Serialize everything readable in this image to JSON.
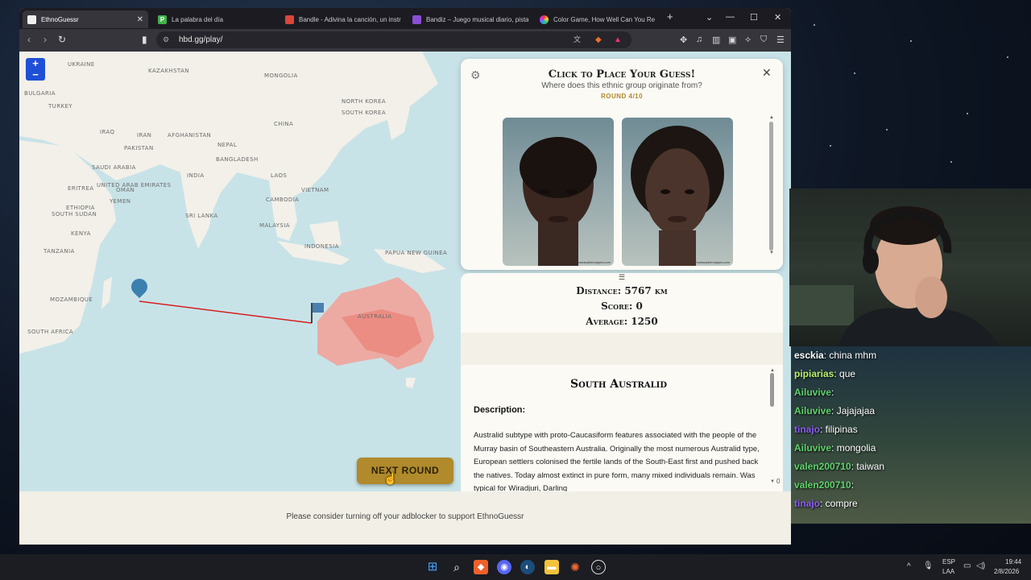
{
  "browser": {
    "tabs": [
      {
        "label": "EthnoGuessr",
        "active": true
      },
      {
        "label": "La palabra del día",
        "active": false
      },
      {
        "label": "Bandle - Adivina la canción, un instr",
        "active": false
      },
      {
        "label": "Bandiz – Juego musical diario, pista",
        "active": false
      },
      {
        "label": "Color Game, How Well Can You Re",
        "active": false
      }
    ],
    "new_tab": "+",
    "url": "hbd.gg/play/"
  },
  "map": {
    "labels": [
      "UKRAINE",
      "KAZAKHSTAN",
      "MONGOLIA",
      "BULGARIA",
      "TURKEY",
      "NORTH KOREA",
      "SOUTH KOREA",
      "CHINA",
      "IRAQ",
      "IRAN",
      "AFGHANISTAN",
      "PAKISTAN",
      "NEPAL",
      "BANGLADESH",
      "SAUDI ARABIA",
      "UNITED ARAB EMIRATES",
      "OMAN",
      "INDIA",
      "LAOS",
      "ERITREA",
      "YEMEN",
      "VIETNAM",
      "CAMBODIA",
      "ETHIOPIA",
      "SOUTH SUDAN",
      "SRI LANKA",
      "MALAYSIA",
      "KENYA",
      "TANZANIA",
      "INDONESIA",
      "PAPUA NEW GUINEA",
      "MOZAMBIQUE",
      "AUSTRALIA",
      "SOUTH AFRICA"
    ],
    "zoom_in": "+",
    "zoom_out": "−",
    "next_round": "NEXT ROUND",
    "footer": "Please consider turning off your adblocker to support EthnoGuessr"
  },
  "guess": {
    "title": "Click to Place Your Guess!",
    "subtitle": "Where does this ethnic group originate from?",
    "round": "ROUND 4/10",
    "faces": [
      "male-face",
      "female-face"
    ],
    "credits": [
      "humanphenotypes.com",
      "humanphenotypes.com"
    ]
  },
  "result": {
    "handle": "☰",
    "distance": "Distance: 5767 km",
    "score": "Score: 0",
    "average": "Average: 1250",
    "group_name": "South Australid",
    "description_label": "Description:",
    "description": "Australid subtype with proto-Caucasiform features associated with the people of the Murray basin of Southeastern Australia. Originally the most numerous Australid type, European settlers colonised the fertile lands of the South-East first and pushed back the natives. Today almost extinct in pure form, many mixed individuals remain. Was typical for Wiradjuri, Darling",
    "scroll_value": "0"
  },
  "chat": [
    {
      "user": "esckia",
      "text": ": china mhm",
      "color": "#ffffff"
    },
    {
      "user": "pipiarias",
      "text": ": que",
      "color": "#b8f06a"
    },
    {
      "user": "Ailuvive",
      "text": ": ",
      "color": "#5fd16b"
    },
    {
      "user": "Ailuvive",
      "text": ": Jajajajaa",
      "color": "#5fd16b"
    },
    {
      "user": "tinajo",
      "text": ": filipinas",
      "color": "#8a5cf0"
    },
    {
      "user": "Ailuvive",
      "text": ": mongolia",
      "color": "#5fd16b"
    },
    {
      "user": "valen200710",
      "text": ": taiwan",
      "color": "#5fd16b"
    },
    {
      "user": "valen200710",
      "text": ": ",
      "color": "#5fd16b"
    },
    {
      "user": "tinajo",
      "text": ": compre",
      "color": "#8a5cf0"
    }
  ],
  "taskbar": {
    "lang": "ESP",
    "lang2": "LAA",
    "time": "19:44",
    "date": "2/8/2026"
  },
  "colors": {
    "accent": "#b08a2b",
    "australia": "#f2a097",
    "guess_line": "#d62020",
    "map_water": "#c8e3e8",
    "map_land": "#f2f0e9"
  }
}
